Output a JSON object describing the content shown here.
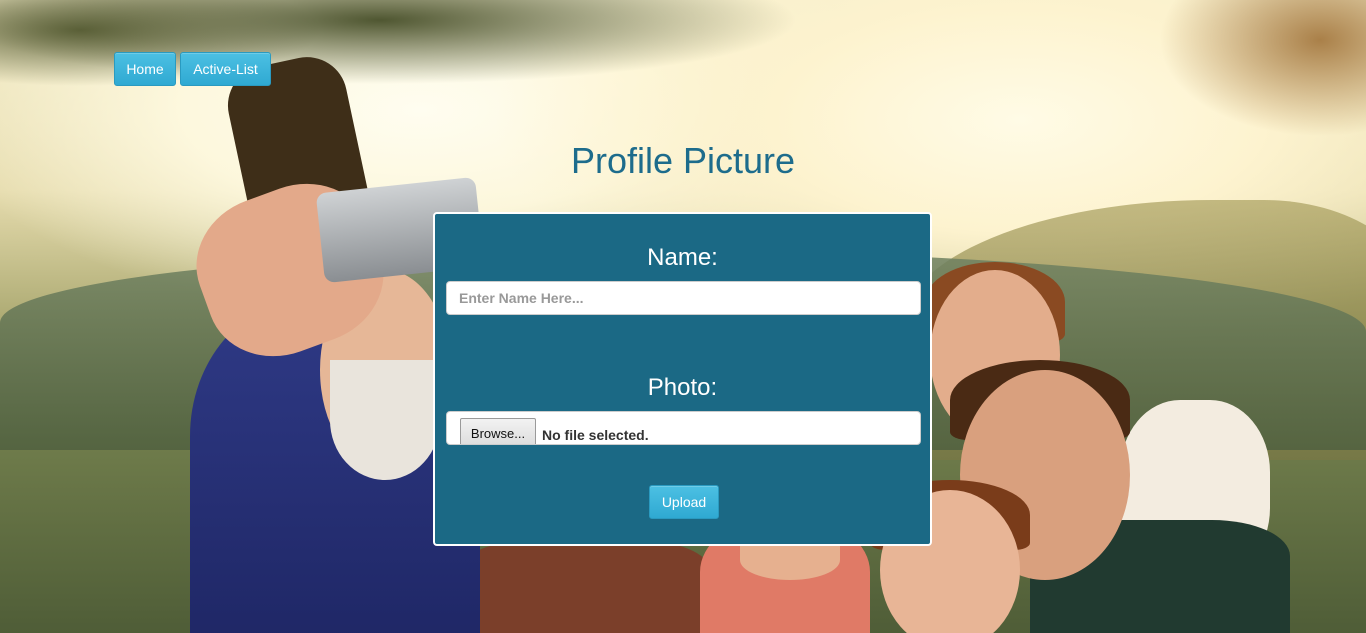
{
  "nav": {
    "home_label": "Home",
    "active_list_label": "Active-List"
  },
  "page": {
    "title": "Profile Picture"
  },
  "form": {
    "name_label": "Name:",
    "name_placeholder": "Enter Name Here...",
    "name_value": "",
    "photo_label": "Photo:",
    "browse_label": "Browse...",
    "file_status": "No file selected.",
    "upload_label": "Upload"
  },
  "colors": {
    "accent_button": "#2fa9d2",
    "panel": "#1b6985",
    "title": "#1d6c8c"
  }
}
